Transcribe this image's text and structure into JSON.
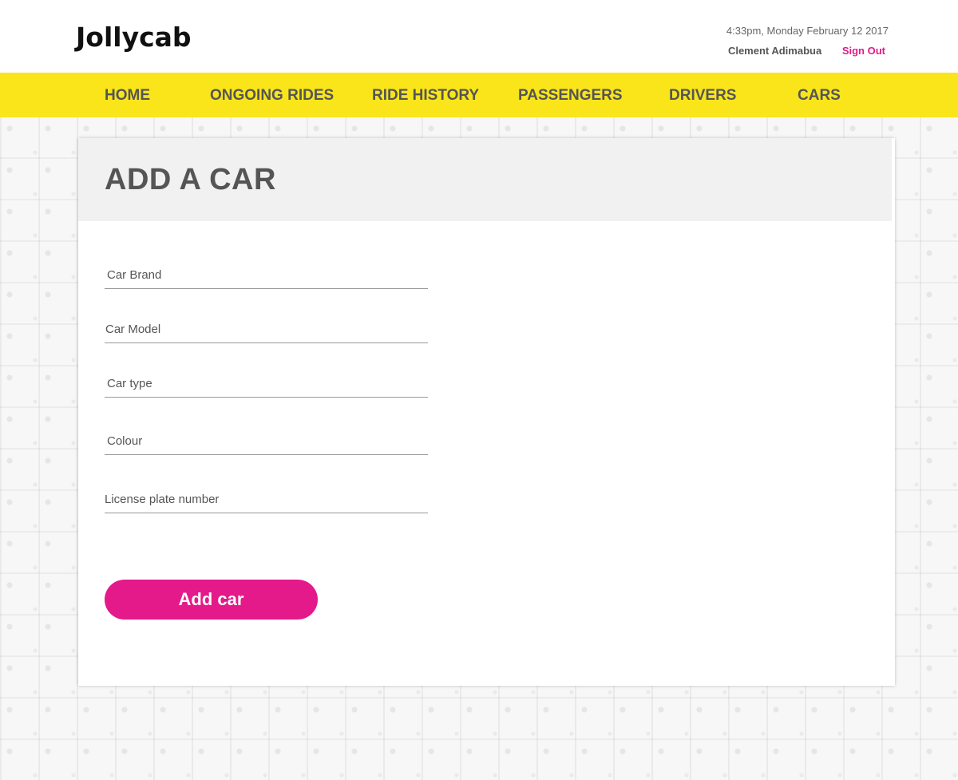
{
  "header": {
    "logo_text": "Jollycab",
    "datetime": "4:33pm, Monday February 12 2017",
    "user_name": "Clement Adimabua",
    "sign_out_label": "Sign Out"
  },
  "nav": {
    "items": [
      {
        "label": "HOME"
      },
      {
        "label": "ONGOING RIDES"
      },
      {
        "label": "RIDE HISTORY"
      },
      {
        "label": "PASSENGERS"
      },
      {
        "label": "DRIVERS"
      },
      {
        "label": "CARS"
      }
    ]
  },
  "form": {
    "title": "ADD A CAR",
    "fields": [
      {
        "placeholder": "Car Brand",
        "value": ""
      },
      {
        "placeholder": "Car Model",
        "value": ""
      },
      {
        "placeholder": "Car type",
        "value": ""
      },
      {
        "placeholder": "Colour",
        "value": ""
      },
      {
        "placeholder": "License plate number",
        "value": ""
      }
    ],
    "submit_label": "Add car"
  },
  "colors": {
    "nav_background": "#f9e51a",
    "accent": "#e4198a",
    "text": "#555555",
    "card_header": "#f1f1f1"
  }
}
